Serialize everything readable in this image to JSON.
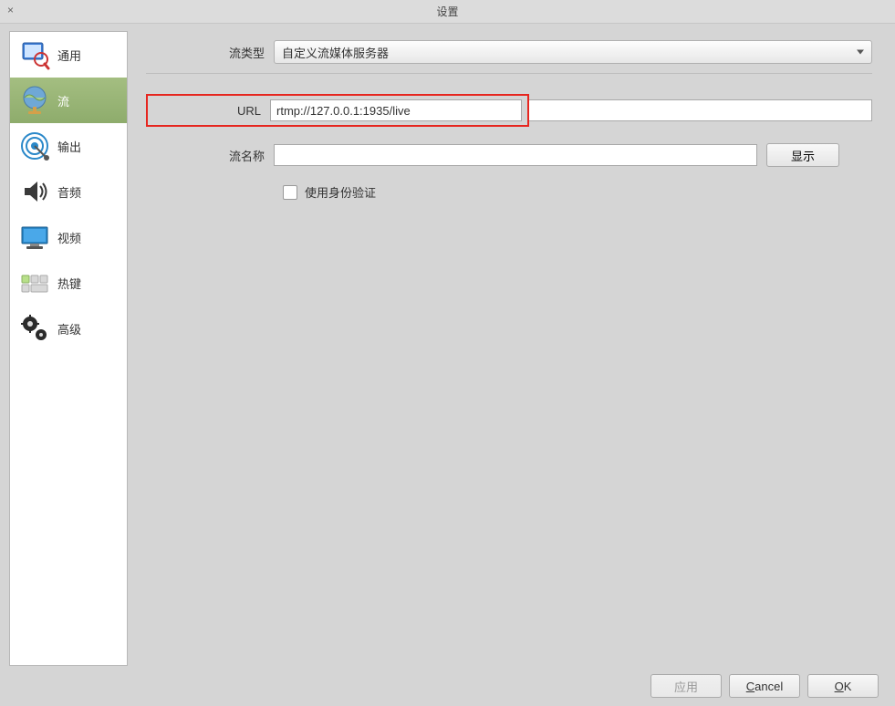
{
  "window": {
    "title": "设置",
    "close_symbol": "×"
  },
  "sidebar": {
    "items": [
      {
        "label": "通用",
        "icon": "general-icon"
      },
      {
        "label": "流",
        "icon": "stream-icon"
      },
      {
        "label": "输出",
        "icon": "output-icon"
      },
      {
        "label": "音频",
        "icon": "audio-icon"
      },
      {
        "label": "视频",
        "icon": "video-icon"
      },
      {
        "label": "热键",
        "icon": "hotkeys-icon"
      },
      {
        "label": "高级",
        "icon": "advanced-icon"
      }
    ],
    "selected_index": 1
  },
  "form": {
    "stream_type_label": "流类型",
    "stream_type_value": "自定义流媒体服务器",
    "url_label": "URL",
    "url_value": "rtmp://127.0.0.1:1935/live",
    "stream_key_label": "流名称",
    "stream_key_value": "",
    "show_button_label": "显示",
    "auth_checkbox_label": "使用身份验证",
    "auth_checked": false
  },
  "footer": {
    "apply_label": "应用",
    "cancel_prefix": "C",
    "cancel_suffix": "ancel",
    "ok_prefix": "O",
    "ok_suffix": "K"
  }
}
